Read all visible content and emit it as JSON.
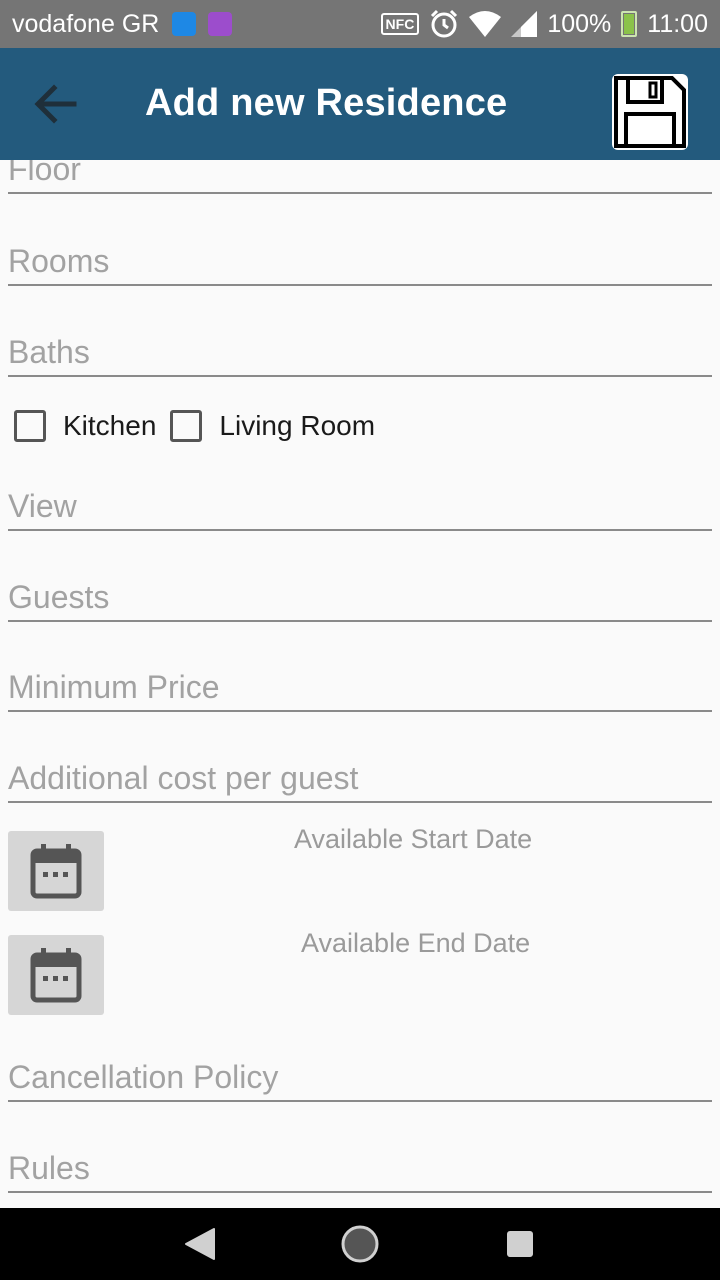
{
  "status_bar": {
    "carrier": "vodafone GR",
    "nfc": "NFC",
    "battery": "100%",
    "time": "11:00"
  },
  "app_bar": {
    "title": "Add new Residence"
  },
  "form": {
    "floor_placeholder": "Floor",
    "rooms_placeholder": "Rooms",
    "baths_placeholder": "Baths",
    "kitchen_label": "Kitchen",
    "living_room_label": "Living Room",
    "view_placeholder": "View",
    "guests_placeholder": "Guests",
    "minimum_price_placeholder": "Minimum Price",
    "additional_cost_placeholder": "Additional cost per guest",
    "start_date_label": "Available Start Date",
    "end_date_label": "Available End Date",
    "cancellation_policy_placeholder": "Cancellation Policy",
    "rules_placeholder": "Rules"
  },
  "colors": {
    "app_bar": "#235a7d",
    "status_bar": "#757575",
    "background": "#fafafa"
  }
}
